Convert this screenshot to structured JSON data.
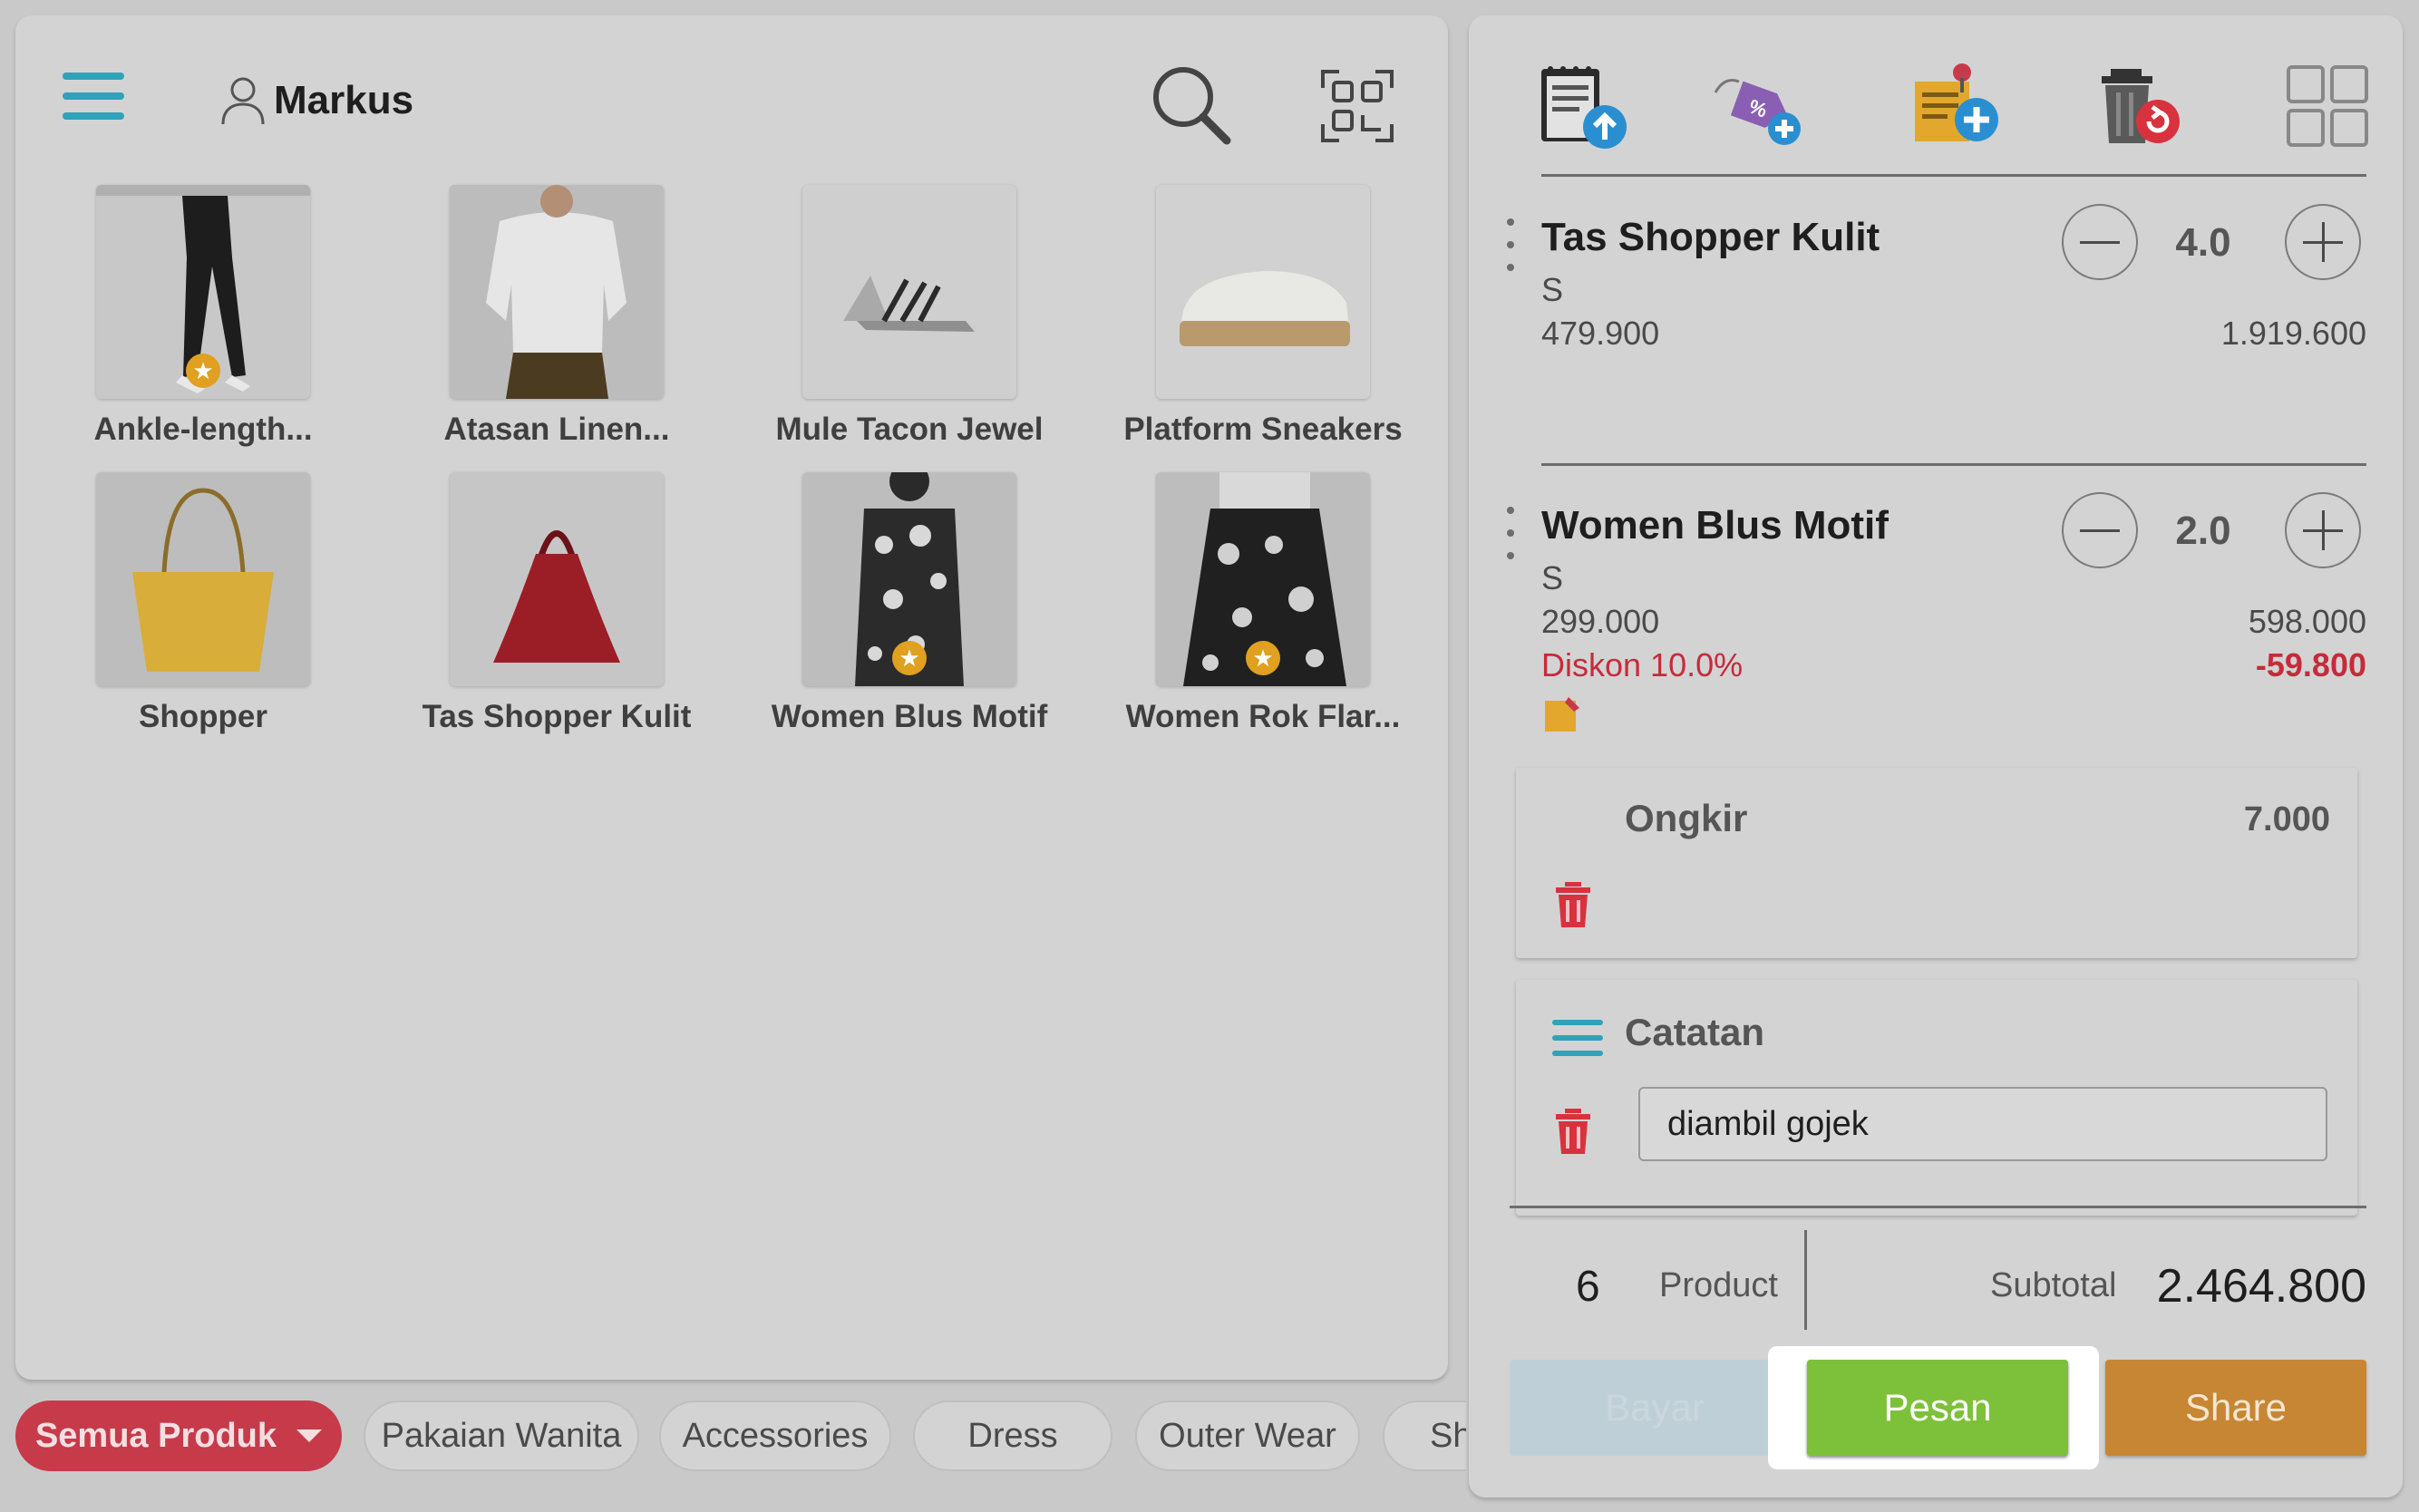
{
  "header": {
    "user_name": "Markus"
  },
  "products": [
    {
      "name": "Ankle-length...",
      "featured": true
    },
    {
      "name": "Atasan Linen...",
      "featured": false
    },
    {
      "name": "Mule Tacon Jewel",
      "featured": false
    },
    {
      "name": "Platform Sneakers",
      "featured": false
    },
    {
      "name": "Shopper",
      "featured": false
    },
    {
      "name": "Tas Shopper Kulit",
      "featured": false
    },
    {
      "name": "Women Blus Motif",
      "featured": true
    },
    {
      "name": "Women Rok Flar...",
      "featured": true
    }
  ],
  "categories": [
    {
      "label": "Semua Produk",
      "active": true
    },
    {
      "label": "Pakaian Wanita",
      "active": false
    },
    {
      "label": "Accessories",
      "active": false
    },
    {
      "label": "Dress",
      "active": false
    },
    {
      "label": "Outer Wear",
      "active": false
    },
    {
      "label": "Sh",
      "active": false
    }
  ],
  "toolbar": {
    "icons": [
      "order-upload-icon",
      "discount-tag-add-icon",
      "note-add-icon",
      "trash-restore-icon",
      "grid-view-icon"
    ]
  },
  "cart": {
    "items": [
      {
        "name": "Tas Shopper Kulit",
        "variant": "S",
        "unit_price": "479.900",
        "quantity": "4.0",
        "line_total": "1.919.600"
      },
      {
        "name": "Women Blus Motif",
        "variant": "S",
        "unit_price": "299.000",
        "quantity": "2.0",
        "line_total": "598.000",
        "discount_label": "Diskon 10.0%",
        "discount_value": "-59.800"
      }
    ],
    "shipping": {
      "label": "Ongkir",
      "value": "7.000"
    },
    "note": {
      "label": "Catatan",
      "value": "diambil gojek"
    }
  },
  "summary": {
    "product_count": "6",
    "product_label": "Product",
    "subtotal_label": "Subtotal",
    "subtotal_value": "2.464.800"
  },
  "actions": {
    "pay_label": "Bayar",
    "order_label": "Pesan",
    "share_label": "Share"
  },
  "colors": {
    "accent_teal": "#2fa3b9",
    "category_active": "#c73a4a",
    "discount_red": "#c62b3b",
    "order_green": "#7dc13a",
    "share_orange": "#c78633"
  }
}
